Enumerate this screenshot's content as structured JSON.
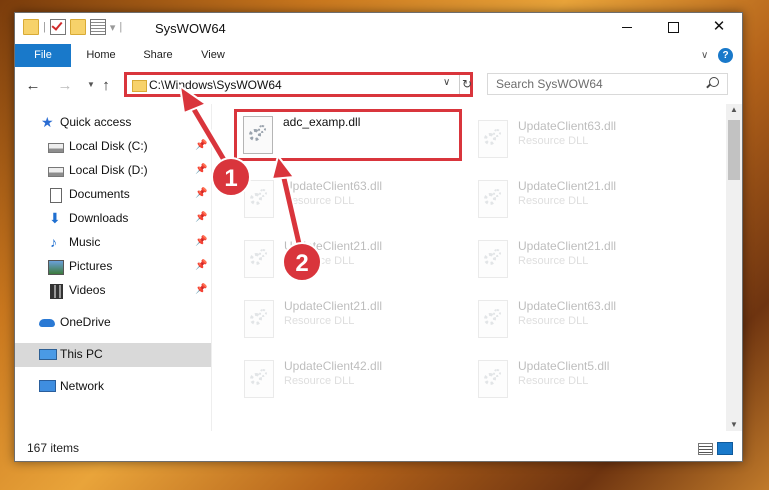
{
  "window": {
    "title": "SysWOW64",
    "controls": {
      "minimize": "—",
      "maximize": "□",
      "close": "✕"
    }
  },
  "ribbon": {
    "tabs": [
      "File",
      "Home",
      "Share",
      "View"
    ],
    "help": "?"
  },
  "navbar": {
    "address": "C:\\Windows\\SysWOW64",
    "search_placeholder": "Search SysWOW64"
  },
  "sidebar": {
    "items": [
      {
        "label": "Quick access",
        "icon": "star-icon",
        "pinned": false
      },
      {
        "label": "Local Disk (C:)",
        "icon": "drive-icon",
        "pinned": true
      },
      {
        "label": "Local Disk (D:)",
        "icon": "drive-icon",
        "pinned": true
      },
      {
        "label": "Documents",
        "icon": "document-icon",
        "pinned": true
      },
      {
        "label": "Downloads",
        "icon": "download-icon",
        "pinned": true
      },
      {
        "label": "Music",
        "icon": "music-icon",
        "pinned": true
      },
      {
        "label": "Pictures",
        "icon": "pictures-icon",
        "pinned": true
      },
      {
        "label": "Videos",
        "icon": "videos-icon",
        "pinned": true
      },
      {
        "label": "OneDrive",
        "icon": "cloud-icon",
        "pinned": false
      },
      {
        "label": "This PC",
        "icon": "computer-icon",
        "pinned": false,
        "selected": true
      },
      {
        "label": "Network",
        "icon": "network-icon",
        "pinned": false
      }
    ]
  },
  "files": [
    {
      "name": "adc_examp.dll",
      "type": "",
      "highlighted": true
    },
    {
      "name": "UpdateClient63.dll",
      "type": "Resource DLL"
    },
    {
      "name": "UpdateClient63.dll",
      "type": "Resource DLL"
    },
    {
      "name": "UpdateClient21.dll",
      "type": "Resource DLL"
    },
    {
      "name": "UpdateClient21.dll",
      "type": "Resource DLL"
    },
    {
      "name": "UpdateClient21.dll",
      "type": "Resource DLL"
    },
    {
      "name": "UpdateClient21.dll",
      "type": "Resource DLL"
    },
    {
      "name": "UpdateClient63.dll",
      "type": "Resource DLL"
    },
    {
      "name": "UpdateClient42.dll",
      "type": "Resource DLL"
    },
    {
      "name": "UpdateClient5.dll",
      "type": "Resource DLL"
    }
  ],
  "status": {
    "item_count": "167 items"
  },
  "annotations": {
    "step1": "1",
    "step2": "2",
    "color": "#d9353c"
  }
}
